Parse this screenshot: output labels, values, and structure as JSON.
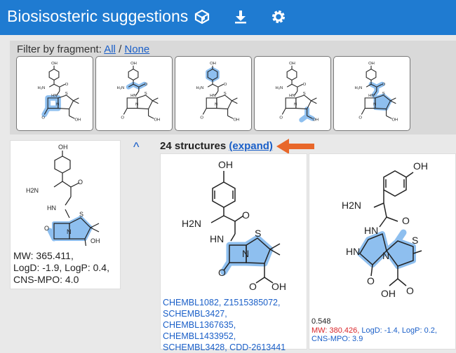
{
  "header": {
    "title": "Biosisosteric suggestions",
    "accent_color": "#1f7bd1",
    "icons": [
      "cube-icon",
      "download-icon",
      "gear-icon"
    ]
  },
  "filter": {
    "label": "Filter by fragment:",
    "all_label": "All",
    "separator": "/",
    "none_label": "None",
    "fragment_count": 5
  },
  "query": {
    "properties_line1": "MW: 365.411,",
    "properties_line2": "LogD: -1.9, LogP: 0.4,",
    "properties_line3": "CNS-MPO: 4.0"
  },
  "results": {
    "count_label": "24 structures",
    "expand_label": "(expand)",
    "collapse_glyph": "^",
    "arrow_color": "#e8672a"
  },
  "result1": {
    "ids_line1": "CHEMBL1082, Z1515385072,",
    "ids_line2": "SCHEMBL3427,",
    "ids_line3": "CHEMBL1367635,",
    "ids_line4": "CHEMBL1433952,",
    "ids_line5": "SCHEMBL3428, CDD-2613441"
  },
  "result2": {
    "score": "0.548",
    "mw": "MW: 380.426,",
    "logd_logp": " LogD: -1.4, LogP: 0.2,",
    "cns": "CNS-MPO: 3.9",
    "mw_color": "#d9262a",
    "rest_color": "#1a5fc8"
  },
  "molecule_labels": {
    "oh": "OH",
    "h2n": "H2N",
    "hn": "HN",
    "o": "O",
    "s": "S",
    "n": "N",
    "h": "H"
  }
}
